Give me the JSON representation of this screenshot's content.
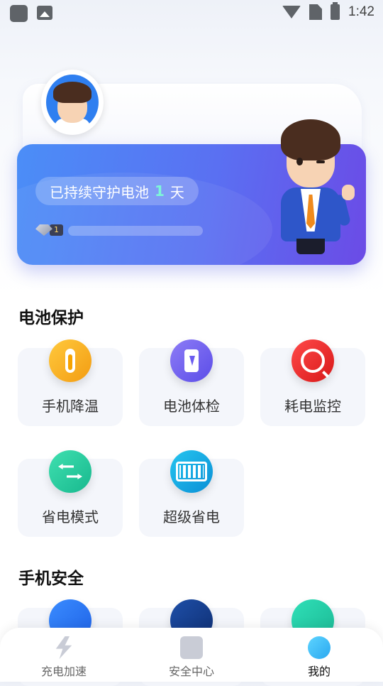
{
  "status_bar": {
    "time": "1:42"
  },
  "banner": {
    "guard_prefix": "已持续守护电池",
    "guard_days": "1",
    "guard_suffix": "天",
    "level": "1",
    "progress": 0.0
  },
  "sections": [
    {
      "title": "电池保护",
      "items": [
        {
          "label": "手机降温",
          "icon": "thermometer-icon",
          "color": "#f5a623"
        },
        {
          "label": "电池体检",
          "icon": "battery-check-icon",
          "color": "#6b5cf0"
        },
        {
          "label": "耗电监控",
          "icon": "power-monitor-icon",
          "color": "#e53935"
        },
        {
          "label": "省电模式",
          "icon": "swap-arrows-icon",
          "color": "#22c7a0"
        },
        {
          "label": "超级省电",
          "icon": "battery-full-icon",
          "color": "#12a6e0"
        }
      ]
    },
    {
      "title": "手机安全",
      "items": [
        {
          "label": "",
          "icon": "gear-icon",
          "color": "#2d72f5"
        },
        {
          "label": "",
          "icon": "camera-icon",
          "color": "#173a8a"
        },
        {
          "label": "",
          "icon": "search-doc-icon",
          "color": "#22c7a0"
        }
      ]
    }
  ],
  "tabs": [
    {
      "label": "充电加速",
      "icon": "lightning-icon",
      "active": false
    },
    {
      "label": "安全中心",
      "icon": "shield-icon",
      "active": false
    },
    {
      "label": "我的",
      "icon": "profile-icon",
      "active": true
    }
  ]
}
